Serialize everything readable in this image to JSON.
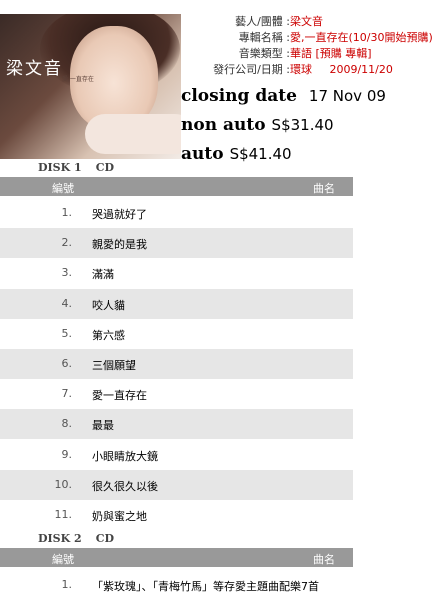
{
  "cover": {
    "artist_text": "梁文音",
    "subtitle_text": "愛,一直存在"
  },
  "info": [
    {
      "key": "藝人/團體 :",
      "value": "梁文音"
    },
    {
      "key": "專輯名稱 :",
      "value": "愛,一直存在(10/30開始預購)"
    },
    {
      "key": "音樂類型 :",
      "value": "華語 [預購 專輯]"
    },
    {
      "key": "發行公司/日期 :",
      "value": "環球     2009/11/20"
    }
  ],
  "promo": {
    "closing_label": "closing date",
    "closing_value": "17 Nov 09",
    "nonauto_label": "non auto",
    "nonauto_value": "S$31.40",
    "auto_label": "auto",
    "auto_value": "S$41.40"
  },
  "disk1": {
    "label": "DISK 1",
    "format": "CD",
    "col_num": "編號",
    "col_title": "曲名",
    "tracks": [
      {
        "n": "1.",
        "t": "哭過就好了"
      },
      {
        "n": "2.",
        "t": "親愛的是我"
      },
      {
        "n": "3.",
        "t": "滿滿"
      },
      {
        "n": "4.",
        "t": "咬人貓"
      },
      {
        "n": "5.",
        "t": "第六感"
      },
      {
        "n": "6.",
        "t": "三個願望"
      },
      {
        "n": "7.",
        "t": "愛一直存在"
      },
      {
        "n": "8.",
        "t": "最最"
      },
      {
        "n": "9.",
        "t": "小眼睛放大鏡"
      },
      {
        "n": "10.",
        "t": "很久很久以後"
      },
      {
        "n": "11.",
        "t": "奶與蜜之地"
      }
    ]
  },
  "disk2": {
    "label": "DISK 2",
    "format": "CD",
    "col_num": "編號",
    "col_title": "曲名",
    "tracks": [
      {
        "n": "1.",
        "t": "「紫玫瑰」、「青梅竹馬」等存愛主題曲配樂7首"
      }
    ]
  }
}
